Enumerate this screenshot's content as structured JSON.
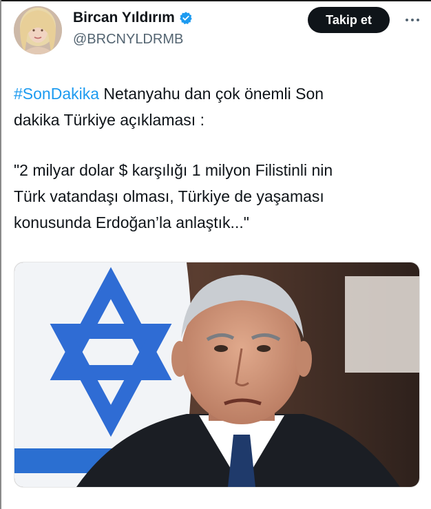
{
  "author": {
    "display_name": "Bircan Yıldırım",
    "handle": "@BRCNYLDRMB",
    "verified_icon": "verified-badge-icon",
    "verified_color": "#1d9bf0"
  },
  "actions": {
    "follow_label": "Takip et",
    "more_icon": "more-options-icon"
  },
  "tweet": {
    "hashtag": "#SonDakika",
    "line1_rest": " Netanyahu dan çok önemli Son",
    "line2": "dakika Türkiye açıklaması :",
    "quote_line1": "\"2 milyar dolar $ karşılığı 1 milyon Filistinli nin",
    "quote_line2": "Türk vatandaşı olması, Türkiye de yaşaması",
    "quote_line3": "konusunda Erdoğan’la anlaştık...\""
  },
  "colors": {
    "hashtag": "#1d9bf0",
    "text": "#0f1419",
    "secondary": "#536471",
    "button_bg": "#0f1419"
  }
}
